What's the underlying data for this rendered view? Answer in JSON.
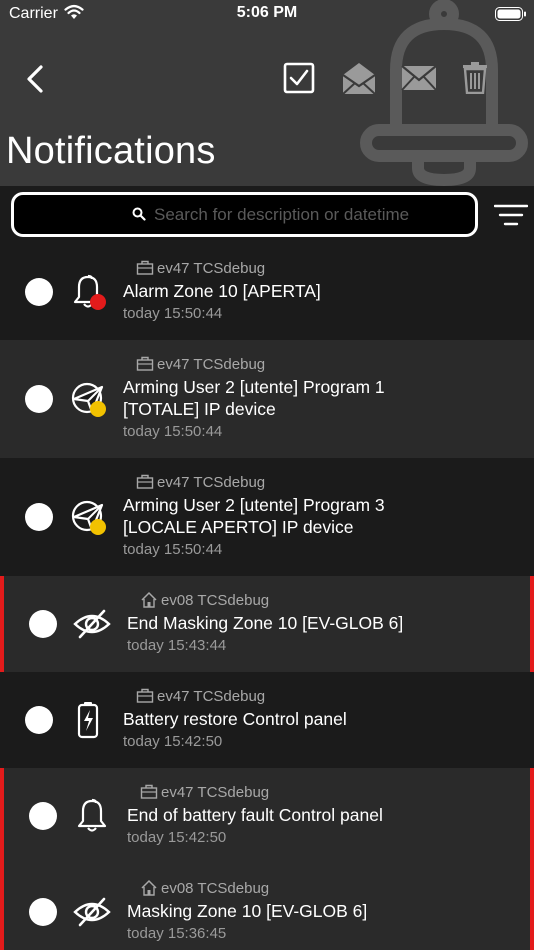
{
  "status_bar": {
    "carrier": "Carrier",
    "time": "5:06 PM"
  },
  "header": {
    "title": "Notifications"
  },
  "search": {
    "placeholder": "Search for description or datetime",
    "value": ""
  },
  "notifications": [
    {
      "icon": "bell-icon",
      "badge": "#e31b1b",
      "source_icon": "briefcase-icon",
      "source": "ev47 TCSdebug",
      "description": "Alarm Zone 10 [APERTA]",
      "datetime": "today 15:50:44",
      "style": "dark"
    },
    {
      "icon": "arming-icon",
      "badge": "#f2c200",
      "source_icon": "briefcase-icon",
      "source": "ev47 TCSdebug",
      "description": "Arming User 2 [utente] Program 1 [TOTALE] IP device",
      "datetime": "today 15:50:44",
      "style": "light"
    },
    {
      "icon": "arming-icon",
      "badge": "#f2c200",
      "source_icon": "briefcase-icon",
      "source": "ev47 TCSdebug",
      "description": "Arming User 2 [utente] Program 3 [LOCALE APERTO] IP device",
      "datetime": "today 15:50:44",
      "style": "dark"
    },
    {
      "icon": "eye-slash-icon",
      "badge": null,
      "source_icon": "home-icon",
      "source": "ev08 TCSdebug",
      "description": "End Masking Zone 10 [EV-GLOB 6]",
      "datetime": "today 15:43:44",
      "style": "alert"
    },
    {
      "icon": "battery-icon",
      "badge": null,
      "source_icon": "briefcase-icon",
      "source": "ev47 TCSdebug",
      "description": "Battery restore Control panel",
      "datetime": "today 15:42:50",
      "style": "dark"
    },
    {
      "icon": "bell-icon",
      "badge": null,
      "source_icon": "briefcase-icon",
      "source": "ev47 TCSdebug",
      "description": "End of battery fault Control panel",
      "datetime": "today 15:42:50",
      "style": "alert"
    },
    {
      "icon": "eye-slash-icon",
      "badge": null,
      "source_icon": "home-icon",
      "source": "ev08 TCSdebug",
      "description": "Masking Zone 10 [EV-GLOB 6]",
      "datetime": "today 15:36:45",
      "style": "alert"
    }
  ]
}
